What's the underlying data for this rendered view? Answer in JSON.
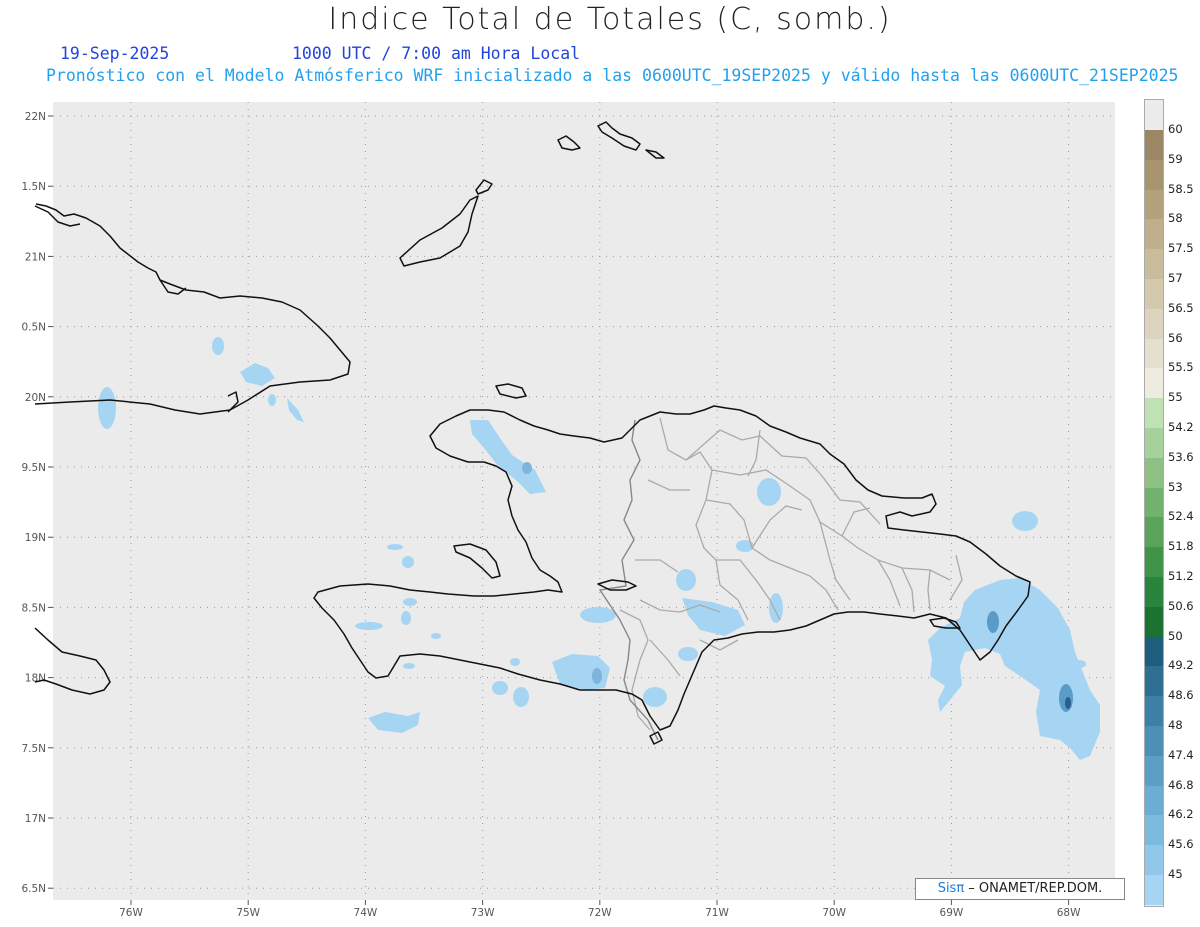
{
  "header": {
    "title": "Indice Total de Totales (C, somb.)",
    "date": "19-Sep-2025",
    "time": "1000 UTC / 7:00 am Hora Local",
    "model_text": "Pronóstico con el Modelo Atmósferico WRF inicializado a las 0600UTC_19SEP2025 y válido hasta las  0600UTC_21SEP2025"
  },
  "map": {
    "background_color": "#ebebeb",
    "latitude_labels": [
      "22N",
      "1.5N",
      "21N",
      "0.5N",
      "20N",
      "9.5N",
      "19N",
      "8.5N",
      "18N",
      "7.5N",
      "17N",
      "6.5N"
    ],
    "longitude_labels": [
      "76W",
      "75W",
      "74W",
      "73W",
      "72W",
      "71W",
      "70W",
      "69W",
      "68W"
    ],
    "shading_colors": [
      "#a6d5f3",
      "#5b9bc8",
      "#2a5f8c"
    ]
  },
  "colorbar": {
    "labels": [
      "60",
      "59",
      "58.5",
      "58",
      "57.5",
      "57",
      "56.5",
      "56",
      "55.5",
      "55",
      "54.2",
      "53.6",
      "53",
      "52.4",
      "51.8",
      "51.2",
      "50.6",
      "50",
      "49.2",
      "48.6",
      "48",
      "47.4",
      "46.8",
      "46.2",
      "45.6",
      "45"
    ],
    "colors": [
      "#9b8763",
      "#a8956f",
      "#b4a27d",
      "#bfaf8c",
      "#c9bc9c",
      "#d3c9ad",
      "#dcd4be",
      "#e5dfcf",
      "#eeebe0",
      "#bfe1b4",
      "#a7d19b",
      "#8dc184",
      "#73b26e",
      "#59a35a",
      "#3f944a",
      "#2a853c",
      "#1c7331",
      "#1e5d7e",
      "#2e6f93",
      "#3d80a6",
      "#4c90b7",
      "#5b9fc6",
      "#6badd3",
      "#7dbadf",
      "#91c7e8",
      "#a6d5f3"
    ]
  },
  "credit": {
    "sis": "Sisπ",
    "org": " – ONAMET/REP.DOM."
  }
}
